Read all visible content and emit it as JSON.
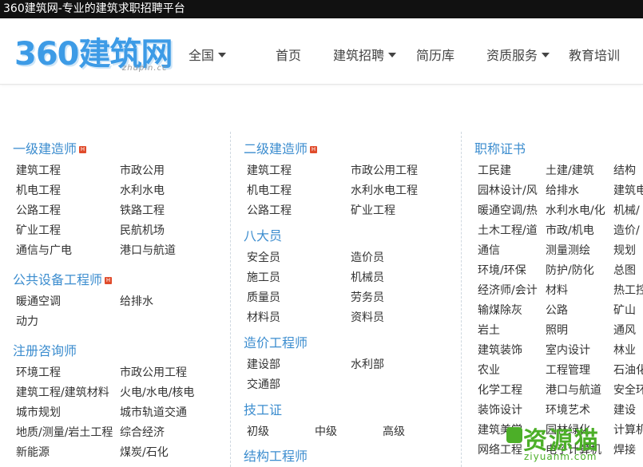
{
  "topbar": {
    "text": "360建筑网-专业的建筑求职招聘平台"
  },
  "header": {
    "logo": "360建筑网",
    "logo_sub": "zhupin.cc",
    "region": "全国",
    "nav": [
      "首页",
      "建筑招聘",
      "简历库",
      "资质服务",
      "教育培训"
    ]
  },
  "col1": {
    "sec1": {
      "title": "一级建造师",
      "badge": "H",
      "items": [
        "建筑工程",
        "市政公用",
        "机电工程",
        "水利水电",
        "公路工程",
        "铁路工程",
        "矿业工程",
        "民航机场",
        "通信与广电",
        "港口与航道"
      ]
    },
    "sec2": {
      "title": "公共设备工程师",
      "badge": "H",
      "items": [
        "暖通空调",
        "给排水",
        "动力"
      ]
    },
    "sec3": {
      "title": "注册咨询师",
      "items": [
        "环境工程",
        "市政公用工程",
        "建筑工程/建筑材料",
        "火电/水电/核电",
        "城市规划",
        "城市轨道交通",
        "地质/测量/岩土工程",
        "综合经济",
        "新能源",
        "煤炭/石化"
      ]
    }
  },
  "col2": {
    "sec1": {
      "title": "二级建造师",
      "badge": "H",
      "items": [
        "建筑工程",
        "市政公用工程",
        "机电工程",
        "水利水电工程",
        "公路工程",
        "矿业工程"
      ]
    },
    "sec2": {
      "title": "八大员",
      "items": [
        "安全员",
        "造价员",
        "施工员",
        "机械员",
        "质量员",
        "劳务员",
        "材料员",
        "资料员"
      ]
    },
    "sec3": {
      "title": "造价工程师",
      "items": [
        "建设部",
        "水利部",
        "交通部"
      ]
    },
    "sec4": {
      "title": "技工证",
      "items": [
        "初级",
        "中级",
        "高级"
      ]
    },
    "sec5": {
      "title": "结构工程师"
    }
  },
  "col3": {
    "sec1": {
      "title": "职称证书",
      "items": [
        "工民建",
        "土建/建筑",
        "结构",
        "园林设计/风",
        "给排水",
        "建筑电",
        "暖通空调/热",
        "水利水电/化",
        "机械/",
        "土木工程/道",
        "市政/机电",
        "造价/",
        "通信",
        "测量测绘",
        "规划",
        "环境/环保",
        "防护/防化",
        "总图",
        "经济师/会计",
        "材料",
        "热工控",
        "输煤除灰",
        "公路",
        "矿山",
        "岩土",
        "照明",
        "通风",
        "建筑装饰",
        "室内设计",
        "林业",
        "农业",
        "工程管理",
        "石油化",
        "化学工程",
        "港口与航道",
        "安全环",
        "装饰设计",
        "环境艺术",
        "建设",
        "建筑美学",
        "园林绿化",
        "计算机",
        "网络工程",
        "电子计算机",
        "焊接"
      ]
    }
  },
  "watermark": {
    "text": "资源猫",
    "sub": "ziyuanm.com"
  }
}
